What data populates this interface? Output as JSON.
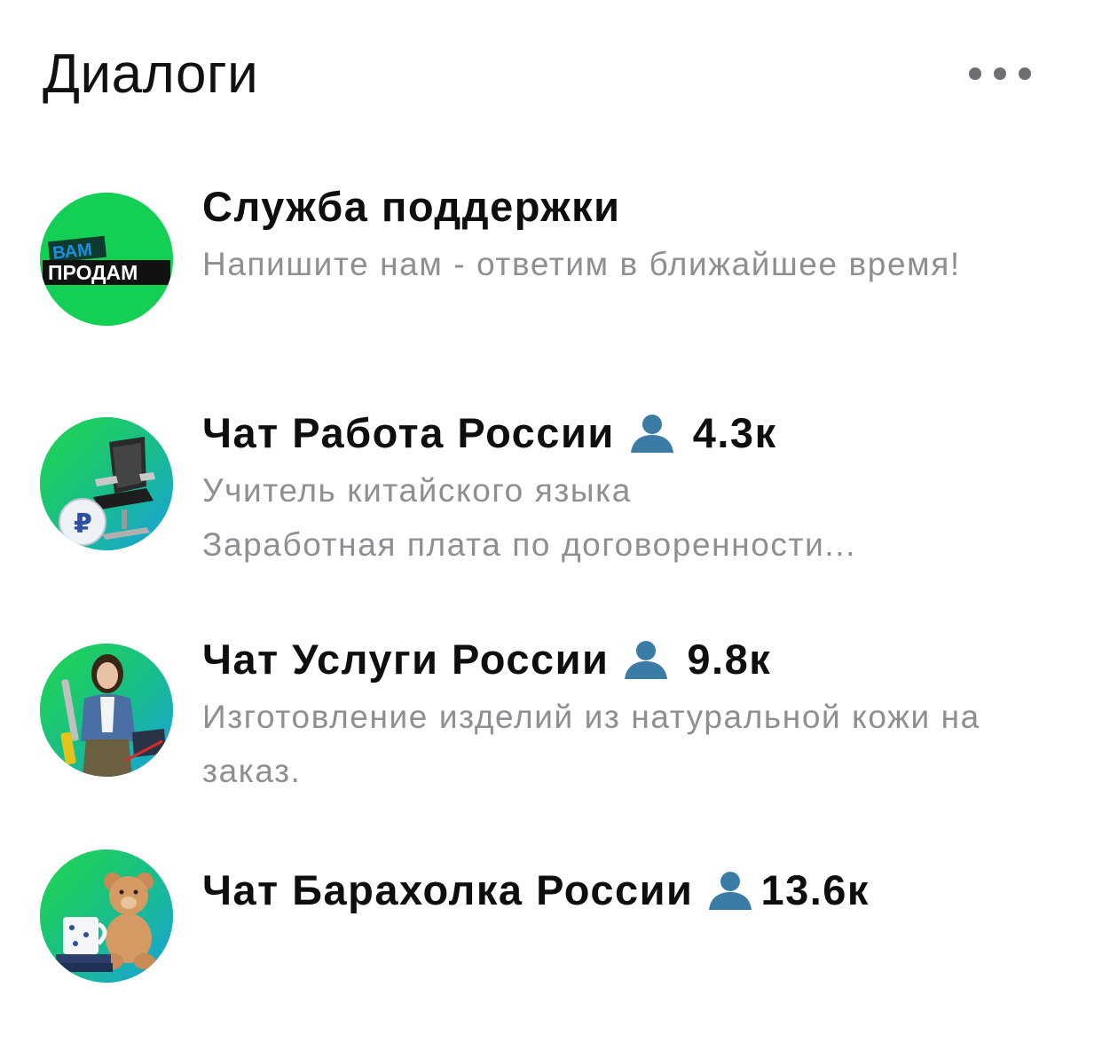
{
  "header": {
    "title": "Диалоги",
    "more_icon": "more-horizontal-icon"
  },
  "dialogs": [
    {
      "title": "Служба поддержки",
      "preview": "Напишите нам - ответим в ближайшее время!",
      "avatar": {
        "icon": "vam-prodam-logo",
        "text_top": "ВАМ",
        "text_bottom": "ПРОДАМ"
      }
    },
    {
      "title": "Чат Работа России",
      "members": "4.3к",
      "preview_lines": [
        "Учитель китайского языка",
        "Заработная плата по договоренности..."
      ],
      "avatar": {
        "icon": "office-chair-image"
      }
    },
    {
      "title": "Чат Услуги России",
      "members": "9.8к",
      "preview": "Изготовление изделий из натуральной кожи на заказ.",
      "avatar": {
        "icon": "woman-with-tools-image"
      }
    },
    {
      "title": "Чат Барахолка России",
      "members": "13.6к",
      "avatar": {
        "icon": "teddy-bear-and-mug-image"
      }
    }
  ],
  "colors": {
    "avatar_gradient": [
      "#1ea0e6",
      "#1fd15a"
    ],
    "preview_text": "#8e8e93",
    "person_icon": "#3a7ca5"
  }
}
